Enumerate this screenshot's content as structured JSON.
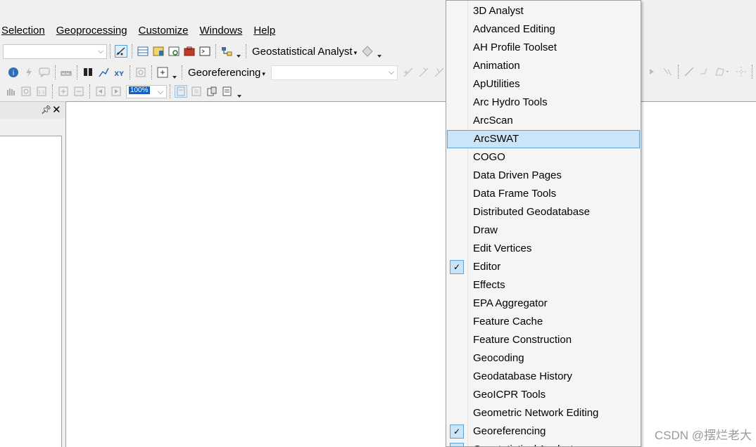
{
  "menubar": [
    {
      "label": "Selection",
      "underline_index": 0
    },
    {
      "label": "Geoprocessing",
      "underline_index": 0
    },
    {
      "label": "Customize",
      "underline_index": 0
    },
    {
      "label": "Windows",
      "underline_index": 0
    },
    {
      "label": "Help",
      "underline_index": 0
    }
  ],
  "toolbar1": {
    "geostat_label": "Geostatistical Analyst"
  },
  "toolbar2": {
    "georef_label": "Georeferencing"
  },
  "toolbar3": {
    "zoom_value": "100%"
  },
  "dropdown": {
    "items": [
      {
        "label": "3D Analyst",
        "checked": false,
        "highlighted": false
      },
      {
        "label": "Advanced Editing",
        "checked": false,
        "highlighted": false
      },
      {
        "label": "AH Profile Toolset",
        "checked": false,
        "highlighted": false
      },
      {
        "label": "Animation",
        "checked": false,
        "highlighted": false
      },
      {
        "label": "ApUtilities",
        "checked": false,
        "highlighted": false
      },
      {
        "label": "Arc Hydro Tools",
        "checked": false,
        "highlighted": false
      },
      {
        "label": "ArcScan",
        "checked": false,
        "highlighted": false
      },
      {
        "label": "ArcSWAT",
        "checked": false,
        "highlighted": true
      },
      {
        "label": "COGO",
        "checked": false,
        "highlighted": false
      },
      {
        "label": "Data Driven Pages",
        "checked": false,
        "highlighted": false
      },
      {
        "label": "Data Frame Tools",
        "checked": false,
        "highlighted": false
      },
      {
        "label": "Distributed Geodatabase",
        "checked": false,
        "highlighted": false
      },
      {
        "label": "Draw",
        "checked": false,
        "highlighted": false
      },
      {
        "label": "Edit Vertices",
        "checked": false,
        "highlighted": false
      },
      {
        "label": "Editor",
        "checked": true,
        "highlighted": false
      },
      {
        "label": "Effects",
        "checked": false,
        "highlighted": false
      },
      {
        "label": "EPA Aggregator",
        "checked": false,
        "highlighted": false
      },
      {
        "label": "Feature Cache",
        "checked": false,
        "highlighted": false
      },
      {
        "label": "Feature Construction",
        "checked": false,
        "highlighted": false
      },
      {
        "label": "Geocoding",
        "checked": false,
        "highlighted": false
      },
      {
        "label": "Geodatabase History",
        "checked": false,
        "highlighted": false
      },
      {
        "label": "GeoICPR Tools",
        "checked": false,
        "highlighted": false
      },
      {
        "label": "Geometric Network Editing",
        "checked": false,
        "highlighted": false
      },
      {
        "label": "Georeferencing",
        "checked": true,
        "highlighted": false
      },
      {
        "label": "Geostatistical Analyst",
        "checked": true,
        "highlighted": false
      }
    ]
  },
  "check_glyph": "✓",
  "watermark": "CSDN @摆烂老大",
  "colors": {
    "highlight_bg": "#cce4f7",
    "highlight_border": "#5aa1d8"
  }
}
